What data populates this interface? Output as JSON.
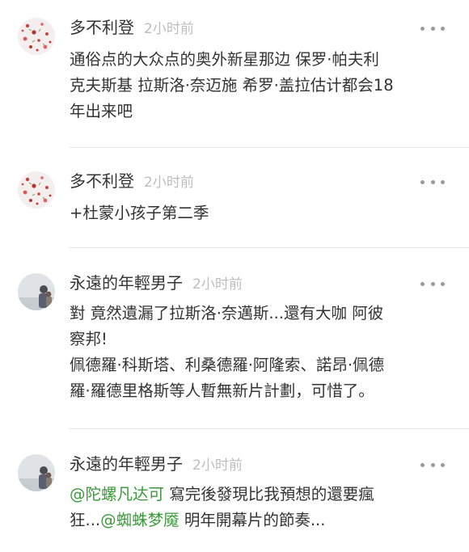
{
  "comments": [
    {
      "username": "多不利登",
      "time": "2小时前",
      "avatar_icon": "floral-avatar",
      "lines": [
        "通俗点的大众点的奥外新星那边 保罗·帕夫利",
        "克夫斯基 拉斯洛·奈迈施 希罗·盖拉估计都会18",
        "年出来吧"
      ]
    },
    {
      "username": "多不利登",
      "time": "2小时前",
      "avatar_icon": "floral-avatar",
      "lines": [
        "+杜蒙小孩子第二季"
      ]
    },
    {
      "username": "永遠的年輕男子",
      "time": "2小时前",
      "avatar_icon": "photo-avatar",
      "lines": [
        "對 竟然遺漏了拉斯洛·奈邁斯...還有大咖 阿彼",
        "察邦!",
        "佩德羅·科斯塔、利桑德羅·阿隆索、諾昂·佩德",
        "羅·羅德里格斯等人暫無新片計劃，可惜了。"
      ]
    },
    {
      "username": "永遠的年輕男子",
      "time": "2小时前",
      "avatar_icon": "photo-avatar",
      "line1": {
        "mention": "@陀螺凡达可",
        "text": " 寫完後發現比我預想的還要瘋"
      },
      "line2": {
        "prefix": "狂...",
        "mention": "@蜘蛛梦魇",
        "text": " 明年開幕片的節奏..."
      }
    }
  ],
  "colors": {
    "mention": "#3a9a3a",
    "time": "#bdbdbd",
    "text": "#333333",
    "divider": "#e6e6e6"
  },
  "icons": {
    "more": "more-dots-icon"
  }
}
